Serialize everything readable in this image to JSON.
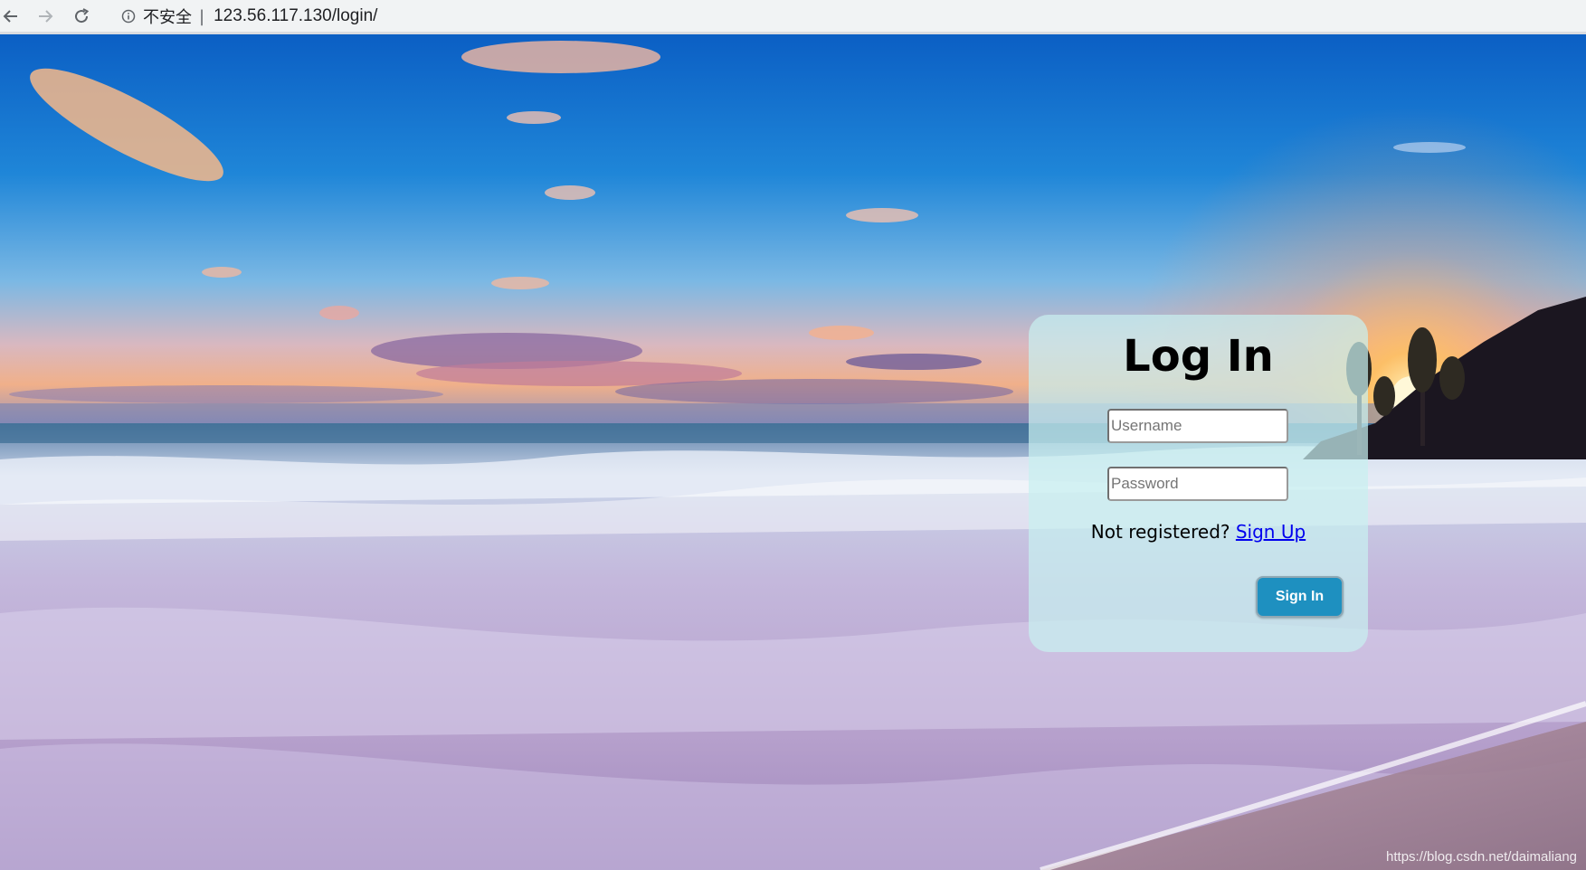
{
  "browser": {
    "security_label": "不安全",
    "separator": "|",
    "url": "123.56.117.130/login/"
  },
  "login": {
    "title": "Log In",
    "username_placeholder": "Username",
    "password_placeholder": "Password",
    "not_registered_text": "Not registered? ",
    "signup_link": "Sign Up",
    "signin_button": "Sign In"
  },
  "watermark": "https://blog.csdn.net/daimaliang",
  "colors": {
    "button_bg": "#1e90c0",
    "link": "#0000ee",
    "card_bg": "rgba(200,240,240,0.72)"
  }
}
